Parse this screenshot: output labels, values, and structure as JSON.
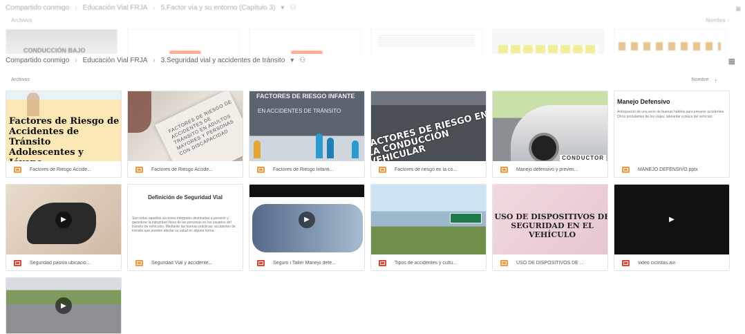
{
  "background_window": {
    "breadcrumbs": [
      "Compartido conmigo",
      "Educación Vial FRJA",
      "5.Factor vía y su entorno (Capítulo 3)"
    ],
    "list_label": "Archivos",
    "sort_label": "Nombre",
    "thumbs": [
      {
        "label": "CONDUCCIÓN BAJO"
      }
    ]
  },
  "header": {
    "breadcrumbs": [
      "Compartido conmigo",
      "Educación Vial FRJA",
      "3.Seguridad vial y accidentes de tránsito"
    ],
    "list_label": "Archivos",
    "sort_label": "Nombre"
  },
  "files": [
    {
      "name": "Factores de Riesgo Accide...",
      "type": "slides",
      "thumb_text": "Factores de Riesgo de Accidentes de Tránsito Adolescentes y Jóvene"
    },
    {
      "name": "Factores de Riesgo Accide...",
      "type": "slides",
      "thumb_text": "FACTORES DE RIESGO DE ACCIDENTES DE TRÁNSITO EN ADULTOS MAYORES Y PERSONAS CON DISCAPACIDAD"
    },
    {
      "name": "Factores de Riesgo Infanti...",
      "type": "slides",
      "thumb_text_1": "FACTORES DE RIESGO INFANTE",
      "thumb_text_2": "EN ACCIDENTES DE TRÁNSITO"
    },
    {
      "name": "Factores de riesgo en la co...",
      "type": "slides",
      "thumb_text": "FACTORES DE RIESGO EN LA CONDUCCIÓN VEHICULAR"
    },
    {
      "name": "Manejo defensivo y preven...",
      "type": "slides",
      "thumb_text": "CONDUCTOR"
    },
    {
      "name": "MANEJO DEFENSIVO.pptx",
      "type": "slides",
      "thumb_title": "Manejo Defensivo",
      "thumb_body": "Anticipación de una serie de buenas hábitos para prevenir accidentes. Otros postulantes de los viajes, adelantar a placa del vehículo."
    },
    {
      "name": "Seguridad pasiva ubicació...",
      "type": "video"
    },
    {
      "name": "Seguridad Vial y accidente...",
      "type": "slides",
      "thumb_title": "Definición de Seguridad Vial",
      "thumb_body": "Son todas aquellas acciones integrales destinadas a prevenir y garantizar la integridad física de las personas en los usuarios del tránsito de vehículos. Mediante las buenas prácticas, accidentes de tránsito que pueden afectar su salud en alguna forma."
    },
    {
      "name": "Seguro i Taller Manejo defe...",
      "type": "video"
    },
    {
      "name": "Tipos de accidentes y cultu...",
      "type": "video"
    },
    {
      "name": "USO DE DISPOSITIVOS DE ...",
      "type": "slides",
      "thumb_text": "USO DE DISPOSITIVOS DE SEGURIDAD EN EL VEHÍCULO"
    },
    {
      "name": "video ciclistas.avi",
      "type": "video"
    },
    {
      "name": "",
      "type": "video"
    }
  ],
  "icons": {
    "slides_color": "#f29a40",
    "video_color": "#db4437",
    "play": "play-icon",
    "sort_arrow": "arrow-up-icon",
    "view": "grid-view-icon"
  }
}
